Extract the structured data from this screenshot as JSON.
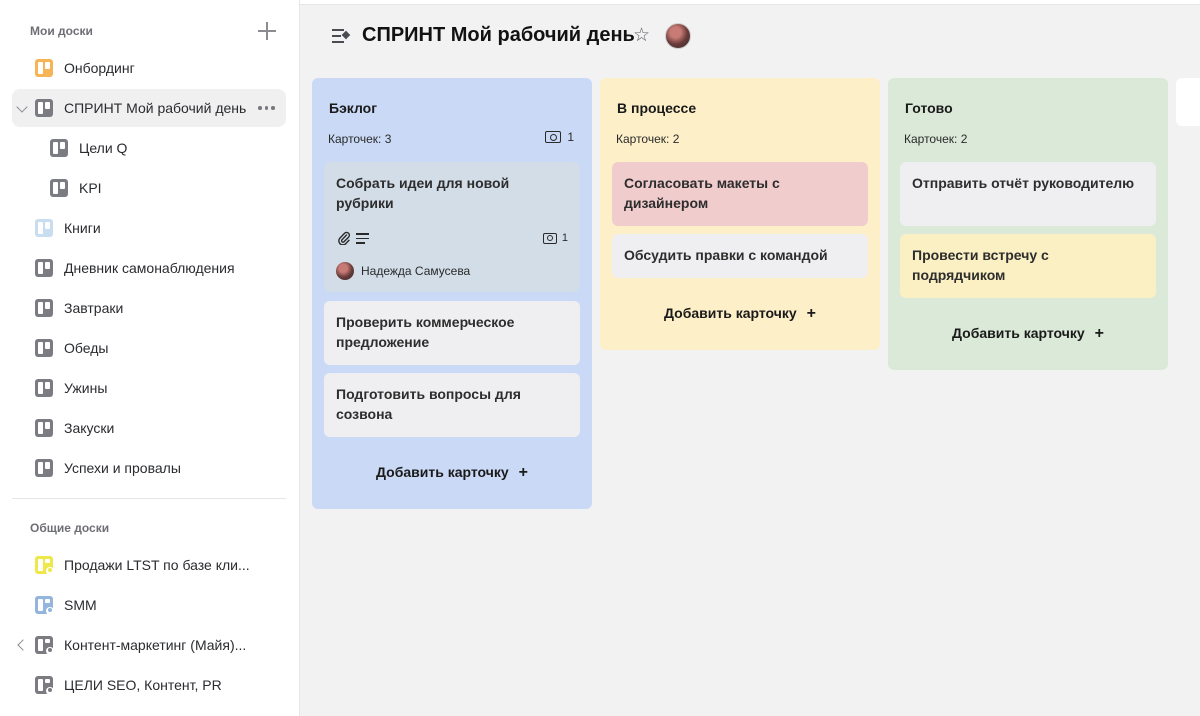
{
  "colors": {
    "accent_orange": "#f5b455",
    "board_gray": "#7a7c82",
    "board_light_blue": "#bcd3ec",
    "board_yellow": "#efe84a",
    "board_blue": "#94b6de",
    "backlog_bg": "#cad9f5",
    "backlog_card_first": "#d2dde8",
    "inprogress_bg": "#fdf0c9",
    "card_red": "#f1cccd",
    "done_bg": "#dbe9d8",
    "card_yellow": "#fbf0c3",
    "card_gray": "#efeff1"
  },
  "sidebar": {
    "my_boards_heading": "Мои доски",
    "add_icon": "plus-icon",
    "my_boards": [
      {
        "label": "Онбординг",
        "color": "#f5b455"
      },
      {
        "label": "СПРИНТ Мой рабочий день",
        "color": "#7a7c82",
        "active": true
      },
      {
        "label": "Цели Q",
        "color": "#7a7c82",
        "child": true
      },
      {
        "label": "KPI",
        "color": "#7a7c82",
        "child": true
      },
      {
        "label": "Книги",
        "color": "#c9ddf0"
      },
      {
        "label": "Дневник самонаблюдения",
        "color": "#7a7c82"
      },
      {
        "label": "Завтраки",
        "color": "#7a7c82"
      },
      {
        "label": "Обеды",
        "color": "#7a7c82"
      },
      {
        "label": "Ужины",
        "color": "#7a7c82"
      },
      {
        "label": "Закуски",
        "color": "#7a7c82"
      },
      {
        "label": "Успехи и провалы",
        "color": "#7a7c82"
      }
    ],
    "shared_boards_heading": "Общие доски",
    "shared_boards": [
      {
        "label": "Продажи LTST по базе кли...",
        "color": "#efe84a"
      },
      {
        "label": "SMM",
        "color": "#94b6de"
      },
      {
        "label": "Контент-маркетинг (Майя)...",
        "color": "#7a7c82"
      },
      {
        "label": "ЦЕЛИ SEO, Контент, PR",
        "color": "#7a7c82"
      }
    ]
  },
  "header": {
    "title": "СПРИНТ Мой рабочий день",
    "star_icon": "☆"
  },
  "columns": [
    {
      "title": "Бэклог",
      "count_label": "Карточек: 3",
      "photos": "1",
      "cards": [
        {
          "title": "Собрать идеи для новой рубрики",
          "photos": "1",
          "assignee": "Надежда Самусева"
        },
        {
          "title": "Проверить коммерческое предложение"
        },
        {
          "title": "Подготовить вопросы для созвона"
        }
      ],
      "add_label": "Добавить карточку"
    },
    {
      "title": "В процессе",
      "count_label": "Карточек: 2",
      "cards": [
        {
          "title": "Согласовать макеты с дизайнером"
        },
        {
          "title": "Обсудить правки с командой"
        }
      ],
      "add_label": "Добавить карточку"
    },
    {
      "title": "Готово",
      "count_label": "Карточек: 2",
      "cards": [
        {
          "title": "Отправить отчёт руководителю"
        },
        {
          "title": "Провести встречу с подрядчиком"
        }
      ],
      "add_label": "Добавить карточку"
    }
  ],
  "add_plus": "+"
}
